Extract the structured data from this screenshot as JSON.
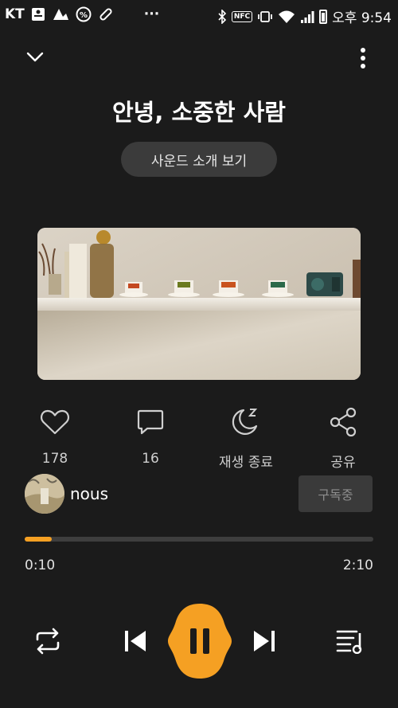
{
  "status_bar": {
    "carrier": "KT",
    "nfc": "NFC",
    "clock": "오후 9:54"
  },
  "header": {
    "title": "안녕, 소중한 사람",
    "sound_intro_button": "사운드 소개 보기"
  },
  "actions": {
    "likes": "178",
    "comments": "16",
    "sleep_timer": "재생 종료",
    "share": "공유"
  },
  "artist": {
    "name": "nous",
    "subscribe_label": "구독중"
  },
  "player": {
    "elapsed": "0:10",
    "duration": "2:10",
    "progress_fraction": 0.0769,
    "accent_color": "#f5a023"
  },
  "icons": [
    "chevron-down-icon",
    "more-vertical-icon",
    "heart-icon",
    "comment-icon",
    "sleep-moon-icon",
    "share-icon",
    "repeat-icon",
    "previous-icon",
    "pause-icon",
    "next-icon",
    "playlist-icon"
  ]
}
